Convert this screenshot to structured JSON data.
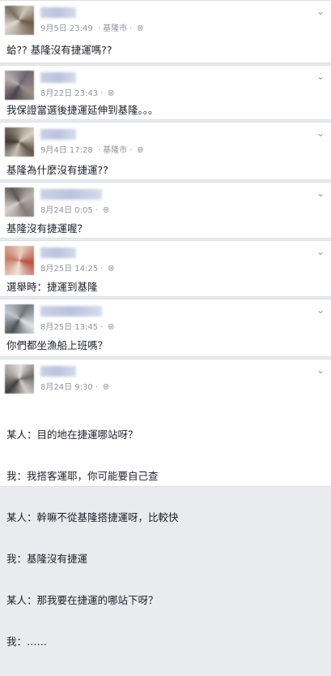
{
  "posts": [
    {
      "date": "9月5日",
      "time": "23:49",
      "location": "基隆市",
      "text": "蛤?? 基隆沒有捷運嗎??"
    },
    {
      "date": "8月22日",
      "time": "23:43",
      "location": "",
      "text": "我保證當選後捷運延伸到基隆。。。"
    },
    {
      "date": "9月4日",
      "time": "17:28",
      "location": "基隆市",
      "text": "基隆為什麼沒有捷運??"
    },
    {
      "date": "8月24日",
      "time": "0:05",
      "location": "",
      "text": "基隆沒有捷運喔？"
    },
    {
      "date": "8月25日",
      "time": "14:25",
      "location": "",
      "text": "選舉時：捷運到基隆"
    },
    {
      "date": "8月25日",
      "time": "13:45",
      "location": "",
      "text": "你們都坐漁船上班嗎？"
    },
    {
      "date": "8月24日",
      "time": "9:30",
      "location": "",
      "lines": [
        "某人：目的地在捷運哪站呀？",
        "我：我搭客運耶，你可能要自己查",
        "某人：幹嘛不從基隆搭捷運呀，比較快",
        "我：基隆沒有捷運",
        "某人：那我要在捷運的哪站下呀？",
        "我：……"
      ]
    }
  ],
  "icons": {
    "globe": "globe-icon",
    "chevron": "chevron-down-icon"
  }
}
